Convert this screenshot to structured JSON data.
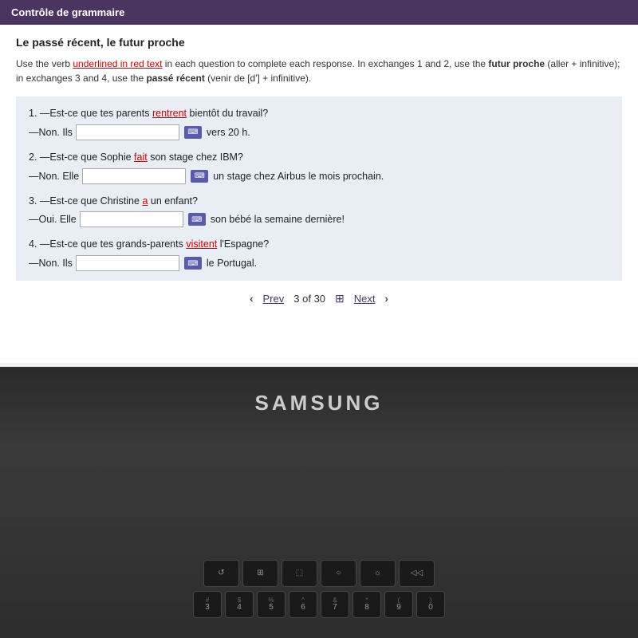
{
  "header": {
    "title": "Contrôle de grammaire"
  },
  "page": {
    "title": "Le passé récent, le futur proche",
    "instructions": {
      "part1": "Use the verb ",
      "underlined_text": "underlined in red text",
      "part2": " in each question to complete each response. In exchanges 1 and 2, use the ",
      "bold1": "futur proche",
      "part3": " (aller + infinitive); in exchanges 3 and 4, use the ",
      "bold2": "passé récent",
      "part4": " (venir de [d'] + infinitive)."
    }
  },
  "questions": [
    {
      "number": "1.",
      "question": "—Est-ce que tes parents rentrent bientôt du travail?",
      "underlined_word": "rentrent",
      "answer_prefix": "—Non. Ils",
      "answer_suffix": " vers 20 h.",
      "has_kbd": true
    },
    {
      "number": "2.",
      "question": "—Est-ce que Sophie fait son stage chez IBM?",
      "underlined_word": "fait",
      "answer_prefix": "—Non. Elle",
      "answer_suffix": " un stage chez Airbus le mois prochain.",
      "has_kbd": true
    },
    {
      "number": "3.",
      "question": "—Est-ce que Christine a un enfant?",
      "underlined_word": "a",
      "answer_prefix": "—Oui. Elle",
      "answer_suffix": " son bébé la semaine dernière!",
      "has_kbd": true
    },
    {
      "number": "4.",
      "question": "—Est-ce que tes grands-parents visitent l'Espagne?",
      "underlined_word": "visitent",
      "answer_prefix": "—Non. Ils",
      "answer_suffix": " le Portugal.",
      "has_kbd": true
    }
  ],
  "pagination": {
    "prev_label": "Prev",
    "next_label": "Next",
    "current": "3",
    "total": "30"
  },
  "laptop": {
    "brand": "SAMSUNG"
  },
  "keyboard": {
    "row1": [
      "↺",
      "⊞",
      "⊡",
      "○",
      "☼",
      "◁◁"
    ],
    "row2_labels": [
      "#\n3",
      "$\n4",
      "%\n5",
      "^\n6",
      "&\n7",
      "*\n8",
      "(\n9",
      ")\n0"
    ]
  }
}
